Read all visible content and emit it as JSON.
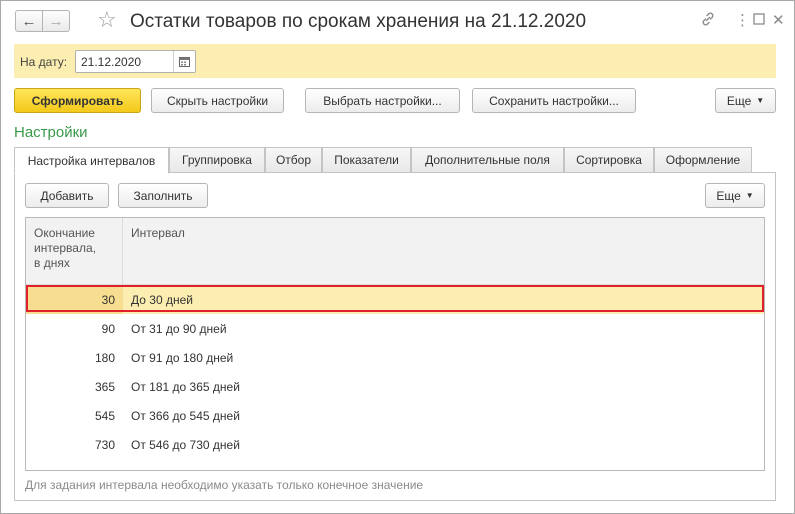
{
  "window": {
    "title": "Остатки товаров по срокам хранения на 21.12.2020",
    "nav_back_icon": "arrow-left",
    "nav_forward_icon": "arrow-right",
    "favorite_icon": "star",
    "link_icon": "chain",
    "more_icon": "vertical-dots",
    "maximize_icon": "square",
    "close_icon": "x"
  },
  "date_panel": {
    "label": "На дату:",
    "value": "21.12.2020",
    "calendar_icon": "calendar"
  },
  "toolbar": {
    "generate_label": "Сформировать",
    "hide_settings_label": "Скрыть настройки",
    "select_settings_label": "Выбрать настройки...",
    "save_settings_label": "Сохранить настройки...",
    "more_label": "Еще"
  },
  "settings": {
    "title": "Настройки",
    "tabs": [
      {
        "label": "Настройка интервалов",
        "active": true
      },
      {
        "label": "Группировка"
      },
      {
        "label": "Отбор"
      },
      {
        "label": "Показатели"
      },
      {
        "label": "Дополнительные поля"
      },
      {
        "label": "Сортировка"
      },
      {
        "label": "Оформление"
      }
    ],
    "add_label": "Добавить",
    "fill_label": "Заполнить",
    "more_label": "Еще",
    "columns": [
      "Окончание интервала, в днях",
      "Интервал"
    ],
    "column1_lines": [
      "Окончание",
      "интервала,",
      "в днях"
    ],
    "rows": [
      {
        "end": "30",
        "interval": "До 30 дней"
      },
      {
        "end": "90",
        "interval": "От 31 до 90 дней"
      },
      {
        "end": "180",
        "interval": "От 91 до 180 дней"
      },
      {
        "end": "365",
        "interval": "От 181 до 365 дней"
      },
      {
        "end": "545",
        "interval": "От 366 до 545 дней"
      },
      {
        "end": "730",
        "interval": "От 546 до 730 дней"
      }
    ],
    "selected_row": 0,
    "hint": "Для задания интервала необходимо указать только конечное значение"
  },
  "colors": {
    "accent_yellow": "#f3c91a",
    "panel_yellow": "#fbeeb0",
    "section_green": "#3a9a4b",
    "highlight_red": "#e0202a"
  }
}
